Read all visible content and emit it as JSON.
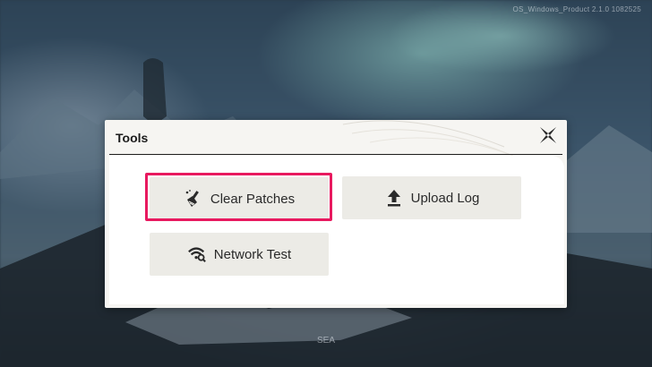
{
  "background": {
    "version_text": "OS_Windows_Product 2.1.0 1082525",
    "region_text": "SEA"
  },
  "dialog": {
    "title": "Tools",
    "close_icon": "close-x-icon",
    "buttons": [
      {
        "label": "Clear Patches",
        "icon": "broom-icon",
        "highlighted": true
      },
      {
        "label": "Upload Log",
        "icon": "upload-arrow-icon",
        "highlighted": false
      },
      {
        "label": "Network Test",
        "icon": "wifi-search-icon",
        "highlighted": false
      }
    ]
  },
  "colors": {
    "highlight": "#e8195f",
    "button_bg": "#ecebe6",
    "dialog_bg": "#f6f5f2"
  }
}
